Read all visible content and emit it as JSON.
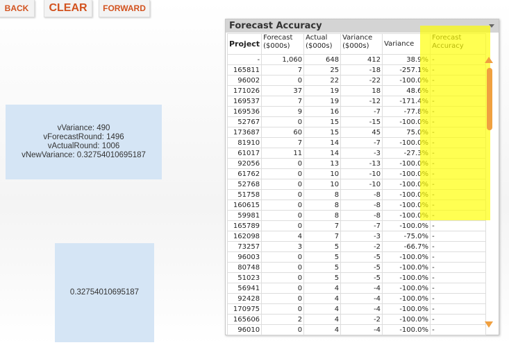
{
  "toolbar": {
    "back": "BACK",
    "clear": "CLEAR",
    "forward": "FORWARD"
  },
  "vars": {
    "l1": "vVariance: 490",
    "l2": "vForecastRound: 1496",
    "l3": "vActualRound: 1006",
    "l4": "vNewVariance: 0.32754010695187"
  },
  "value_box": "0.32754010695187",
  "table": {
    "title": "Forecast Accuracy",
    "headers": [
      "Project",
      "Forecast ($000s)",
      "Actual ($000s)",
      "Variance ($000s)",
      "Variance",
      "Forecast Accuracy"
    ],
    "rows": [
      [
        "-",
        "1,060",
        "648",
        "412",
        "38.9%",
        "-"
      ],
      [
        "165811",
        "7",
        "25",
        "-18",
        "-257.1%",
        "-"
      ],
      [
        "96002",
        "0",
        "22",
        "-22",
        "-100.0%",
        "-"
      ],
      [
        "171026",
        "37",
        "19",
        "18",
        "48.6%",
        "-"
      ],
      [
        "169537",
        "7",
        "19",
        "-12",
        "-171.4%",
        "-"
      ],
      [
        "169536",
        "9",
        "16",
        "-7",
        "-77.8%",
        "-"
      ],
      [
        "52767",
        "0",
        "15",
        "-15",
        "-100.0%",
        "-"
      ],
      [
        "173687",
        "60",
        "15",
        "45",
        "75.0%",
        "-"
      ],
      [
        "81910",
        "7",
        "14",
        "-7",
        "-100.0%",
        "-"
      ],
      [
        "61017",
        "11",
        "14",
        "-3",
        "-27.3%",
        "-"
      ],
      [
        "92056",
        "0",
        "13",
        "-13",
        "-100.0%",
        "-"
      ],
      [
        "61762",
        "0",
        "10",
        "-10",
        "-100.0%",
        "-"
      ],
      [
        "52768",
        "0",
        "10",
        "-10",
        "-100.0%",
        "-"
      ],
      [
        "51758",
        "0",
        "8",
        "-8",
        "-100.0%",
        "-"
      ],
      [
        "160615",
        "0",
        "8",
        "-8",
        "-100.0%",
        "-"
      ],
      [
        "59981",
        "0",
        "8",
        "-8",
        "-100.0%",
        "-"
      ],
      [
        "165789",
        "0",
        "7",
        "-7",
        "-100.0%",
        "-"
      ],
      [
        "162098",
        "4",
        "7",
        "-3",
        "-75.0%",
        "-"
      ],
      [
        "73257",
        "3",
        "5",
        "-2",
        "-66.7%",
        "-"
      ],
      [
        "96003",
        "0",
        "5",
        "-5",
        "-100.0%",
        "-"
      ],
      [
        "80748",
        "0",
        "5",
        "-5",
        "-100.0%",
        "-"
      ],
      [
        "51023",
        "0",
        "5",
        "-5",
        "-100.0%",
        "-"
      ],
      [
        "56941",
        "0",
        "4",
        "-4",
        "-100.0%",
        "-"
      ],
      [
        "92428",
        "0",
        "4",
        "-4",
        "-100.0%",
        "-"
      ],
      [
        "170975",
        "0",
        "4",
        "-4",
        "-100.0%",
        "-"
      ],
      [
        "165606",
        "2",
        "4",
        "-2",
        "-100.0%",
        "-"
      ],
      [
        "96010",
        "0",
        "4",
        "-4",
        "-100.0%",
        "-"
      ]
    ]
  },
  "colors": {
    "accent": "#d2521e",
    "highlight": "#ffff00",
    "scrollbar": "#f0a040"
  }
}
